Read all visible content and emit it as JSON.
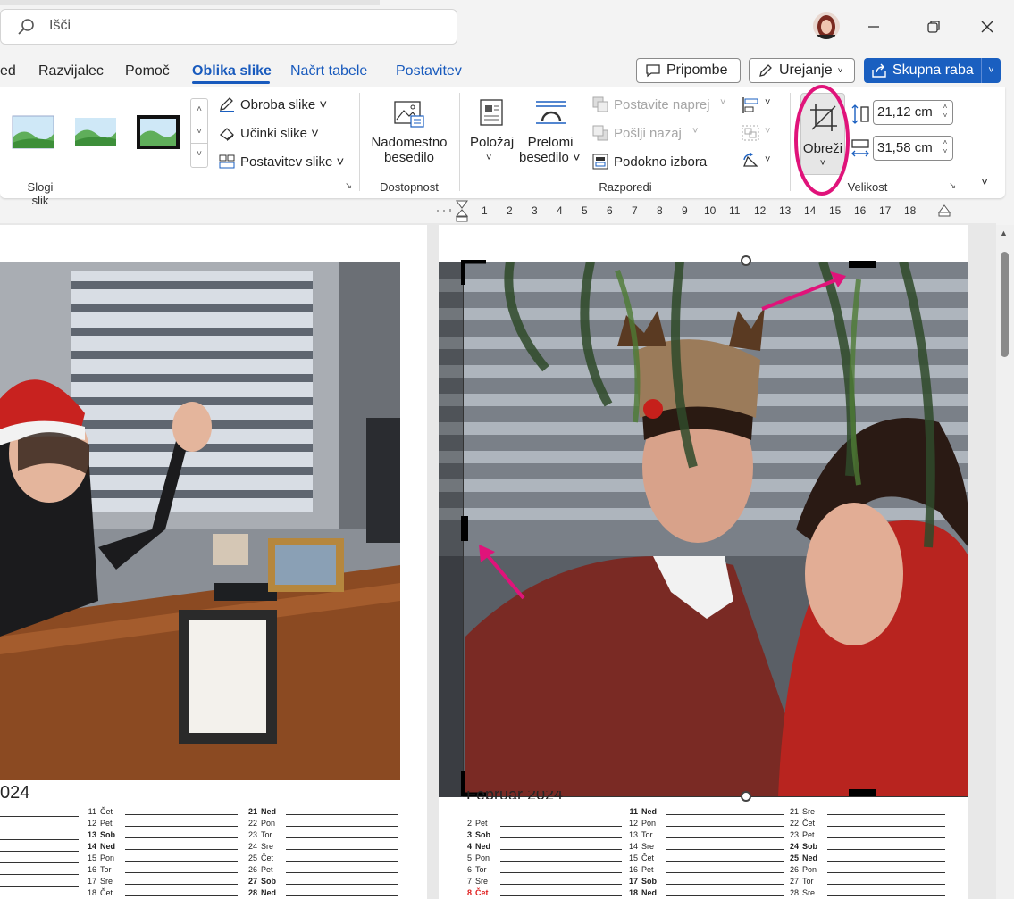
{
  "search": {
    "placeholder": "Išči"
  },
  "tabs": [
    {
      "label": "ed"
    },
    {
      "label": "Razvijalec"
    },
    {
      "label": "Pomoč"
    },
    {
      "label": "Oblika slike"
    },
    {
      "label": "Načrt tabele"
    },
    {
      "label": "Postavitev"
    }
  ],
  "buttons": {
    "comments": "Pripombe",
    "editing": "Urejanje",
    "share": "Skupna raba"
  },
  "ribbon": {
    "picture_styles_label": "Slogi slik",
    "picture_border": "Obroba slike",
    "picture_effects": "Učinki slike",
    "picture_layout": "Postavitev slike",
    "alt_text_line1": "Nadomestno",
    "alt_text_line2": "besedilo",
    "accessibility_label": "Dostopnost",
    "position": "Položaj",
    "wrap_line1": "Prelomi",
    "wrap_line2": "besedilo",
    "bring_forward": "Postavite naprej",
    "send_backward": "Pošlji nazaj",
    "selection_pane": "Podokno izbora",
    "arrange_label": "Razporedi",
    "crop": "Obreži",
    "height": "21,12 cm",
    "width": "31,58 cm",
    "size_label": "Velikost"
  },
  "ruler": [
    "1",
    "2",
    "3",
    "4",
    "5",
    "6",
    "7",
    "8",
    "9",
    "10",
    "11",
    "12",
    "13",
    "14",
    "15",
    "16",
    "17",
    "18"
  ],
  "left_page": {
    "month_fragment": "024",
    "col2": [
      {
        "n": "11",
        "d": "Čet",
        "style": ""
      },
      {
        "n": "12",
        "d": "Pet",
        "style": ""
      },
      {
        "n": "13",
        "d": "Sob",
        "style": "bold"
      },
      {
        "n": "14",
        "d": "Ned",
        "style": "bold"
      },
      {
        "n": "15",
        "d": "Pon",
        "style": ""
      },
      {
        "n": "16",
        "d": "Tor",
        "style": ""
      },
      {
        "n": "17",
        "d": "Sre",
        "style": ""
      },
      {
        "n": "18",
        "d": "Čet",
        "style": ""
      }
    ],
    "col3": [
      {
        "n": "21",
        "d": "Ned",
        "style": "bold"
      },
      {
        "n": "22",
        "d": "Pon",
        "style": ""
      },
      {
        "n": "23",
        "d": "Tor",
        "style": ""
      },
      {
        "n": "24",
        "d": "Sre",
        "style": ""
      },
      {
        "n": "25",
        "d": "Čet",
        "style": ""
      },
      {
        "n": "26",
        "d": "Pet",
        "style": ""
      },
      {
        "n": "27",
        "d": "Sob",
        "style": "bold"
      },
      {
        "n": "28",
        "d": "Ned",
        "style": "bold"
      }
    ]
  },
  "right_page": {
    "month_title": "Februar 2024",
    "col1": [
      {
        "n": "2",
        "d": "Pet",
        "style": ""
      },
      {
        "n": "3",
        "d": "Sob",
        "style": "bold"
      },
      {
        "n": "4",
        "d": "Ned",
        "style": "bold"
      },
      {
        "n": "5",
        "d": "Pon",
        "style": ""
      },
      {
        "n": "6",
        "d": "Tor",
        "style": ""
      },
      {
        "n": "7",
        "d": "Sre",
        "style": ""
      },
      {
        "n": "8",
        "d": "Čet",
        "style": "red"
      }
    ],
    "col2": [
      {
        "n": "11",
        "d": "Ned",
        "style": "bold"
      },
      {
        "n": "12",
        "d": "Pon",
        "style": ""
      },
      {
        "n": "13",
        "d": "Tor",
        "style": ""
      },
      {
        "n": "14",
        "d": "Sre",
        "style": ""
      },
      {
        "n": "15",
        "d": "Čet",
        "style": ""
      },
      {
        "n": "16",
        "d": "Pet",
        "style": ""
      },
      {
        "n": "17",
        "d": "Sob",
        "style": "bold"
      },
      {
        "n": "18",
        "d": "Ned",
        "style": "bold"
      }
    ],
    "col3": [
      {
        "n": "21",
        "d": "Sre",
        "style": ""
      },
      {
        "n": "22",
        "d": "Čet",
        "style": ""
      },
      {
        "n": "23",
        "d": "Pet",
        "style": ""
      },
      {
        "n": "24",
        "d": "Sob",
        "style": "bold"
      },
      {
        "n": "25",
        "d": "Ned",
        "style": "bold"
      },
      {
        "n": "26",
        "d": "Pon",
        "style": ""
      },
      {
        "n": "27",
        "d": "Tor",
        "style": ""
      },
      {
        "n": "28",
        "d": "Sre",
        "style": ""
      }
    ]
  },
  "colors": {
    "accent": "#185abd",
    "share": "#1a5fc0",
    "annotation": "#e0137a"
  }
}
